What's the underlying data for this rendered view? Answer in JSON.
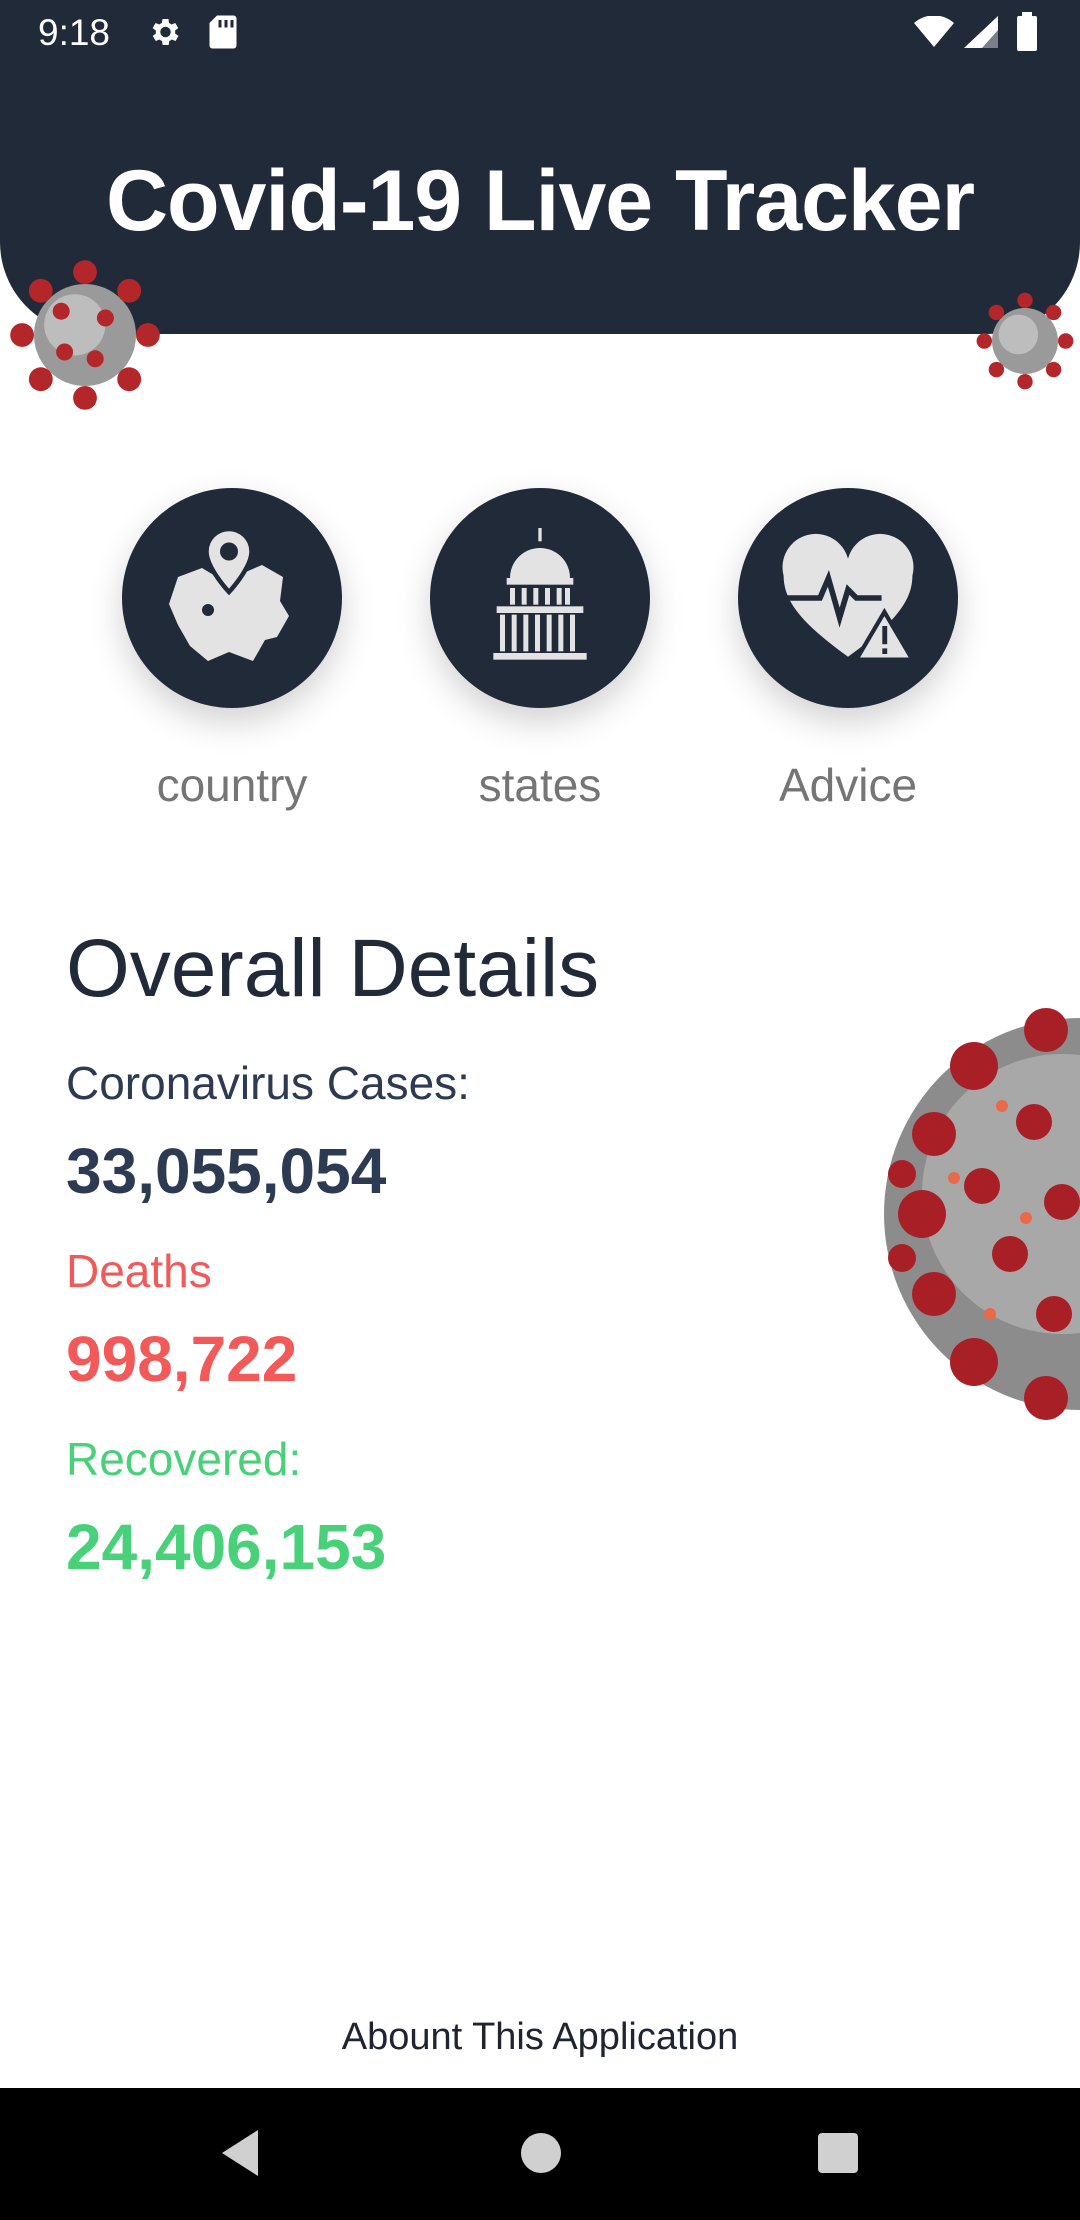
{
  "status_bar": {
    "time": "9:18",
    "icons": [
      "settings-icon",
      "sd-card-icon",
      "wifi-icon",
      "cell-signal-icon",
      "battery-icon"
    ]
  },
  "header": {
    "title": "Covid-19 Live Tracker",
    "background": "#212a38"
  },
  "menu": {
    "items": [
      {
        "label": "country",
        "icon": "country-map-pin-icon"
      },
      {
        "label": "states",
        "icon": "capitol-building-icon"
      },
      {
        "label": "Advice",
        "icon": "heart-pulse-warning-icon"
      }
    ]
  },
  "overall": {
    "title": "Overall Details",
    "cases_label": "Coronavirus Cases:",
    "cases_value": "33,055,054",
    "deaths_label": "Deaths",
    "deaths_value": "998,722",
    "recovered_label": "Recovered:",
    "recovered_value": "24,406,153"
  },
  "footer": {
    "about_label": "Abount This Application"
  },
  "colors": {
    "dark": "#212a38",
    "deaths": "#f25a5a",
    "recovered": "#49d17a",
    "label_gray": "#757575"
  },
  "nav": {
    "icons": [
      "back-icon",
      "home-icon",
      "recents-icon"
    ]
  }
}
